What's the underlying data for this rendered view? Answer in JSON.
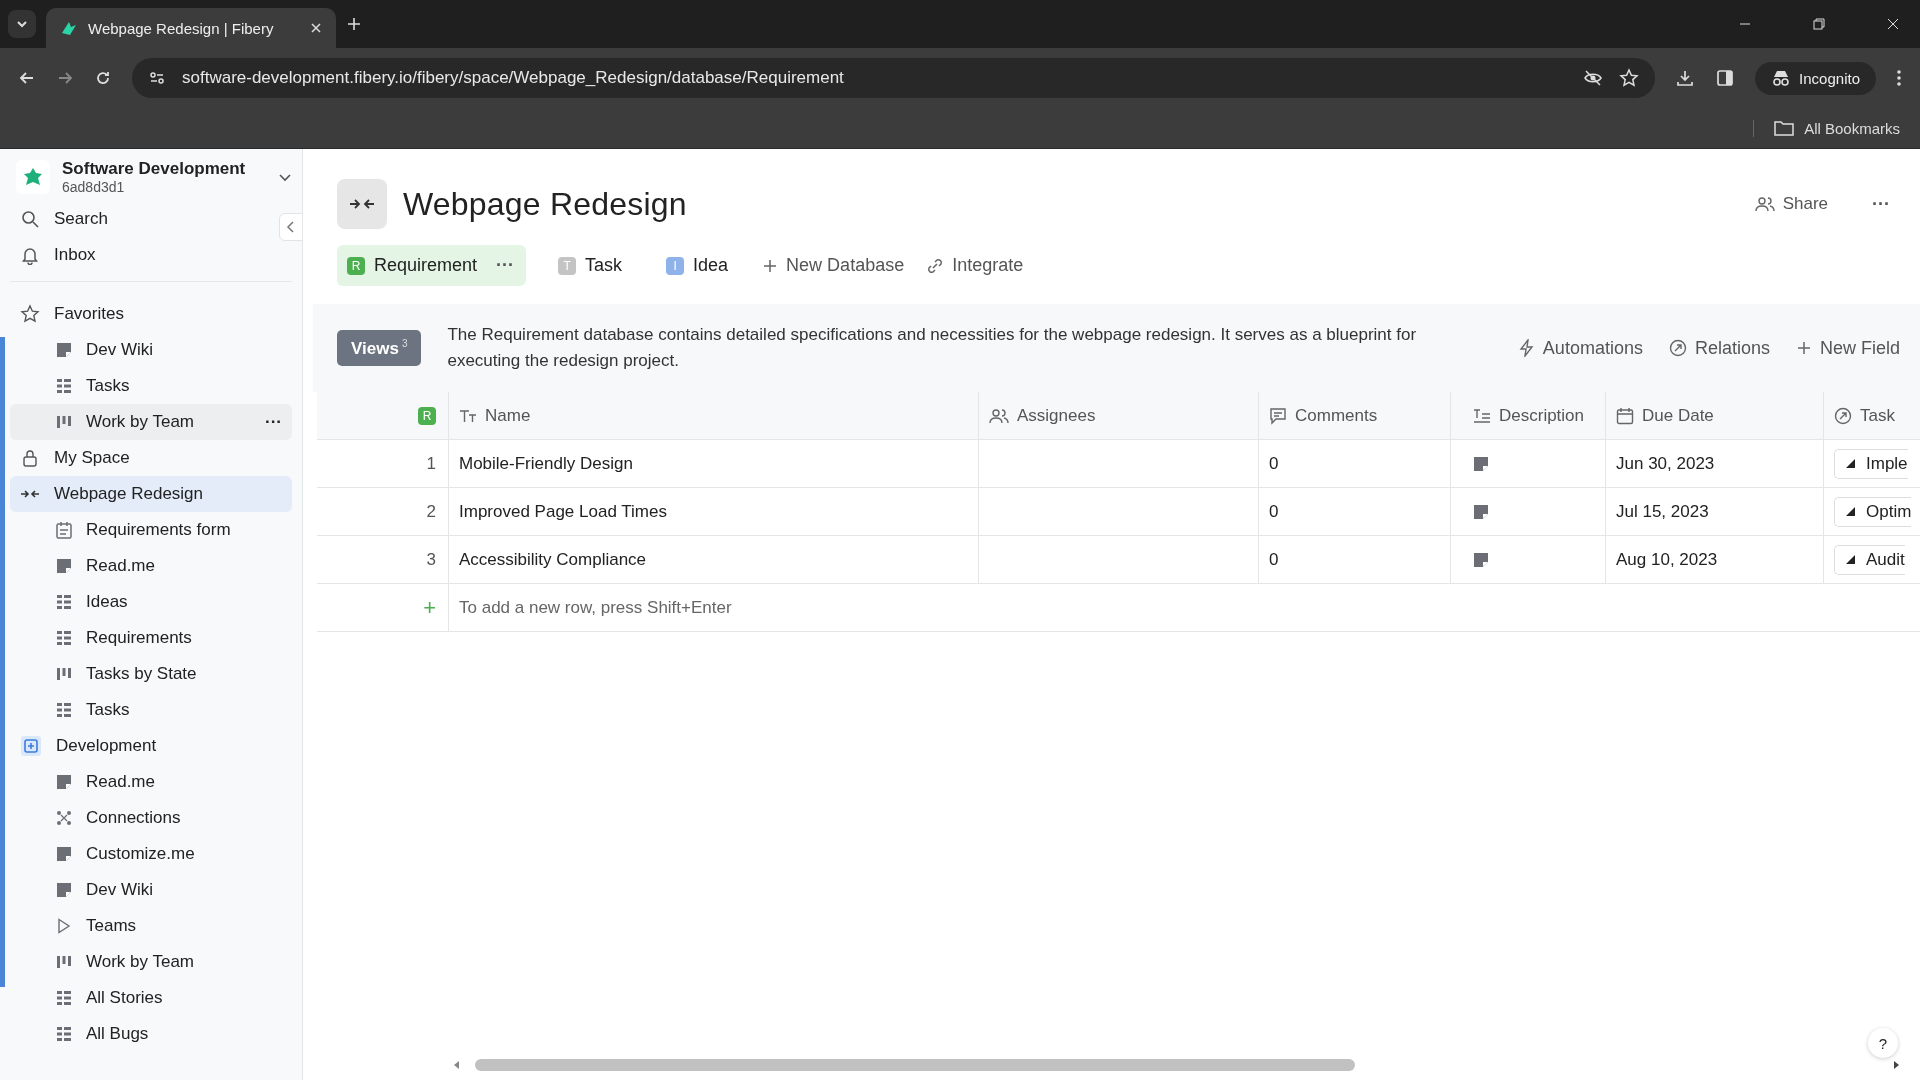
{
  "browser": {
    "tab_title": "Webpage Redesign | Fibery",
    "url": "software-development.fibery.io/fibery/space/Webpage_Redesign/database/Requirement",
    "profile": "Incognito",
    "bookmarks": "All Bookmarks"
  },
  "workspace": {
    "name": "Software Development",
    "id": "6ad8d3d1"
  },
  "sidebar": {
    "top": [
      {
        "label": "Search",
        "kind": "search"
      },
      {
        "label": "Inbox",
        "kind": "bell"
      }
    ],
    "sections": [
      {
        "label": "Favorites",
        "kind": "star",
        "selected": false,
        "children": [
          {
            "label": "Dev Wiki",
            "kind": "doc",
            "hovered": false
          },
          {
            "label": "Tasks",
            "kind": "grid",
            "hovered": false
          },
          {
            "label": "Work by Team",
            "kind": "board",
            "hovered": true
          }
        ]
      },
      {
        "label": "My Space",
        "kind": "lock",
        "selected": false
      },
      {
        "label": "Webpage Redesign",
        "kind": "arrows",
        "selected": true,
        "children": [
          {
            "label": "Requirements form",
            "kind": "form",
            "hovered": false
          },
          {
            "label": "Read.me",
            "kind": "doc",
            "hovered": false
          },
          {
            "label": "Ideas",
            "kind": "grid",
            "hovered": false
          },
          {
            "label": "Requirements",
            "kind": "grid",
            "hovered": false
          },
          {
            "label": "Tasks by State",
            "kind": "board",
            "hovered": false
          },
          {
            "label": "Tasks",
            "kind": "grid",
            "hovered": false
          }
        ]
      },
      {
        "label": "Development",
        "kind": "plus",
        "selected": false,
        "children": [
          {
            "label": "Read.me",
            "kind": "doc",
            "hovered": false
          },
          {
            "label": "Connections",
            "kind": "connections",
            "hovered": false
          },
          {
            "label": "Customize.me",
            "kind": "doc",
            "hovered": false
          },
          {
            "label": "Dev Wiki",
            "kind": "doc",
            "hovered": false
          },
          {
            "label": "Teams",
            "kind": "play",
            "hovered": false
          },
          {
            "label": "Work by Team",
            "kind": "board",
            "hovered": false
          },
          {
            "label": "All Stories",
            "kind": "grid",
            "hovered": false
          },
          {
            "label": "All Bugs",
            "kind": "grid",
            "hovered": false
          }
        ]
      }
    ]
  },
  "page": {
    "title": "Webpage Redesign",
    "share": "Share",
    "more": "···",
    "databases": [
      {
        "label": "Requirement",
        "badge": "R",
        "color": "#4caf50",
        "selected": true,
        "more": "···"
      },
      {
        "label": "Task",
        "badge": "T",
        "color": "#c4c4c4",
        "selected": false
      },
      {
        "label": "Idea",
        "badge": "I",
        "color": "#8fb2ea",
        "selected": false
      }
    ],
    "actions": [
      {
        "label": "New Database",
        "kind": "plus"
      },
      {
        "label": "Integrate",
        "kind": "link"
      }
    ],
    "views": {
      "label": "Views",
      "count": "3"
    },
    "description": "The Requirement database contains detailed specifications and necessities for the webpage redesign. It serves as a blueprint for executing the redesign project.",
    "tools": [
      {
        "label": "Automations",
        "kind": "bolt"
      },
      {
        "label": "Relations",
        "kind": "relation"
      },
      {
        "label": "New Field",
        "kind": "plus"
      }
    ]
  },
  "table": {
    "badge": "R",
    "columns": [
      {
        "label": "Name",
        "kind": "text"
      },
      {
        "label": "Assignees",
        "kind": "people"
      },
      {
        "label": "Comments",
        "kind": "comment"
      },
      {
        "label": "Description",
        "kind": "lines"
      },
      {
        "label": "Due Date",
        "kind": "calendar"
      },
      {
        "label": "Task",
        "kind": "relation"
      }
    ],
    "rows": [
      {
        "index": "1",
        "name": "Mobile-Friendly Design",
        "comments": "0",
        "due": "Jun 30, 2023",
        "task": "Imple"
      },
      {
        "index": "2",
        "name": "Improved Page Load Times",
        "comments": "0",
        "due": "Jul 15, 2023",
        "task": "Optim"
      },
      {
        "index": "3",
        "name": "Accessibility Compliance",
        "comments": "0",
        "due": "Aug 10, 2023",
        "task": "Audit"
      }
    ],
    "add_row": {
      "icon": "+",
      "hint": "To add a new row, press Shift+Enter"
    }
  },
  "help": "?"
}
